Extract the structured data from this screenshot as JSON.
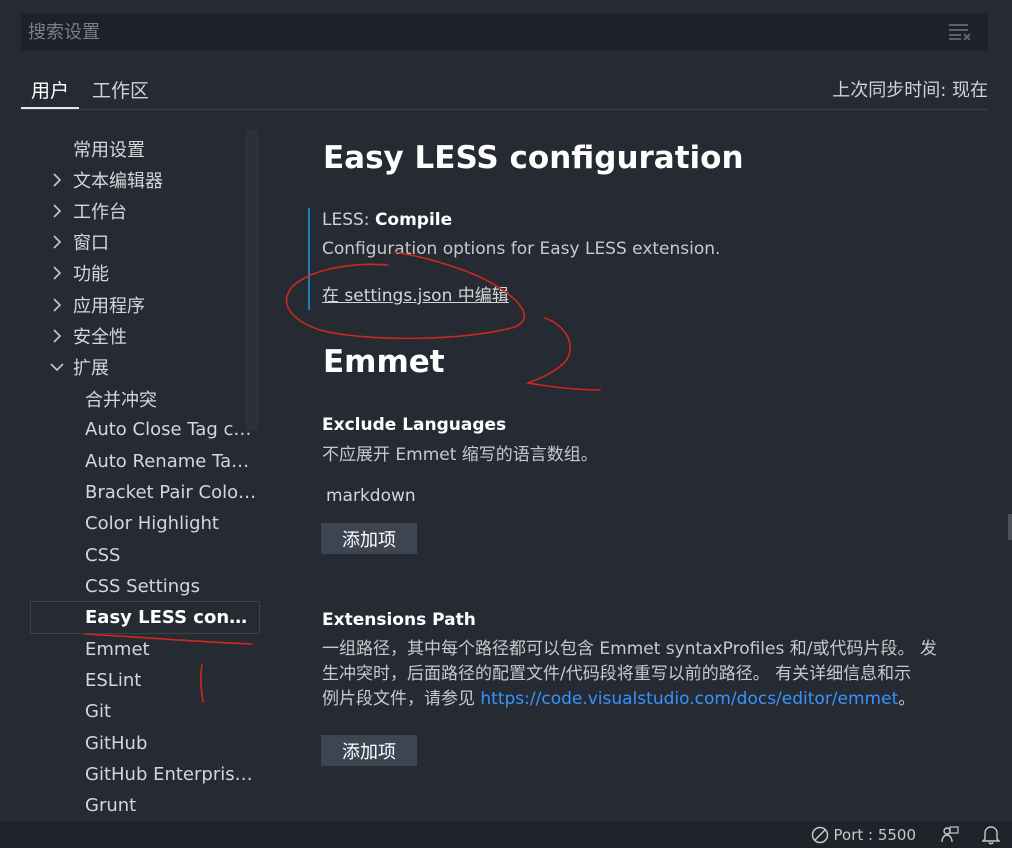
{
  "search": {
    "placeholder": "搜索设置"
  },
  "tabs": [
    {
      "label": "用户",
      "active": true
    },
    {
      "label": "工作区",
      "active": false
    }
  ],
  "sync_status": "上次同步时间: 现在",
  "tree": {
    "items": [
      {
        "label": "常用设置"
      },
      {
        "label": "文本编辑器"
      },
      {
        "label": "工作台"
      },
      {
        "label": "窗口"
      },
      {
        "label": "功能"
      },
      {
        "label": "应用程序"
      },
      {
        "label": "安全性"
      },
      {
        "label": "扩展"
      }
    ],
    "extensions": [
      {
        "label": "合并冲突"
      },
      {
        "label": "Auto Close Tag con..."
      },
      {
        "label": "Auto Rename Tag c..."
      },
      {
        "label": "Bracket Pair Coloriz..."
      },
      {
        "label": "Color Highlight"
      },
      {
        "label": "CSS"
      },
      {
        "label": "CSS Settings"
      },
      {
        "label": "Easy LESS configu..."
      },
      {
        "label": "Emmet"
      },
      {
        "label": "ESLint"
      },
      {
        "label": "Git"
      },
      {
        "label": "GitHub"
      },
      {
        "label": "GitHub Enterprise ..."
      },
      {
        "label": "Grunt"
      }
    ]
  },
  "content": {
    "section1": {
      "title": "Easy LESS configuration",
      "setting_category": "LESS: ",
      "setting_name": "Compile",
      "setting_desc": "Configuration options for Easy LESS extension.",
      "edit_link": "在 settings.json 中编辑"
    },
    "section2": {
      "title": "Emmet",
      "exclude": {
        "name": "Exclude Languages",
        "desc": "不应展开 Emmet 缩写的语言数组。",
        "item": "markdown",
        "add_label": "添加项"
      },
      "ext_path": {
        "name": "Extensions Path",
        "desc_line1": "一组路径，其中每个路径都可以包含 Emmet syntaxProfiles 和/或代码片段。 发",
        "desc_line2": "生冲突时，后面路径的配置文件/代码段将重写以前的路径。 有关详细信息和示",
        "desc_line3_prefix": "例片段文件，请参见 ",
        "desc_link": "https://code.visualstudio.com/docs/editor/emmet",
        "desc_line3_suffix": "。",
        "add_label": "添加项"
      }
    }
  },
  "status_bar": {
    "port": "Port : 5500"
  },
  "colors": {
    "accent_link": "#3794ff",
    "setting_bar": "#1f7fb2",
    "annotation": "#d0261e"
  }
}
